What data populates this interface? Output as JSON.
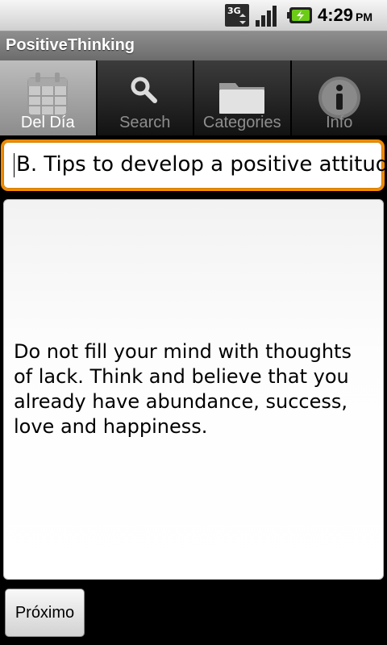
{
  "status_bar": {
    "network": "3G",
    "time": "4:29",
    "ampm": "PM",
    "icons": [
      "3g-data-icon",
      "signal-strength-icon",
      "battery-charging-icon"
    ]
  },
  "app": {
    "title": "PositiveThinking"
  },
  "tabs": [
    {
      "label": "Del Día",
      "icon": "calendar-icon",
      "active": true
    },
    {
      "label": "Search",
      "icon": "search-icon",
      "active": false
    },
    {
      "label": "Categories",
      "icon": "folder-icon",
      "active": false
    },
    {
      "label": "Info",
      "icon": "info-icon",
      "active": false
    }
  ],
  "subject": {
    "value": "B. Tips to develop a positive attitude"
  },
  "content": {
    "text": "Do not fill your mind with thoughts of lack. Think and believe that you already have abundance, success, love and happiness."
  },
  "actions": {
    "next_label": "Próximo"
  },
  "colors": {
    "focus": "#f08a00",
    "tab_active": "#a5a5a5",
    "tab_inactive": "#222222"
  }
}
